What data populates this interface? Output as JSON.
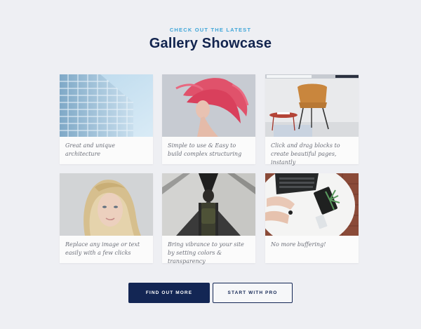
{
  "section": {
    "eyebrow": "CHECK OUT THE LATEST",
    "title": "Gallery Showcase"
  },
  "gallery": [
    {
      "caption": "Great and unique architecture",
      "image": "glass-building-photo"
    },
    {
      "caption": "Simple to use & Easy to build complex structuring",
      "image": "red-hair-woman-photo"
    },
    {
      "caption": "Click and drag blocks to create beautiful pages, instantly",
      "image": "chair-interior-photo"
    },
    {
      "caption": "Replace any image or text easily with a few clicks",
      "image": "blonde-woman-portrait-photo"
    },
    {
      "caption": "Bring vibrance to your site by setting colors & transparency",
      "image": "backpack-man-bridge-photo"
    },
    {
      "caption": "No more buffering!",
      "image": "laptop-desk-photo"
    }
  ],
  "buttons": {
    "primary": "FIND OUT MORE",
    "secondary": "START WITH PRO"
  },
  "colors": {
    "background": "#eeeff3",
    "accent": "#3fa6d8",
    "navy": "#132654"
  }
}
